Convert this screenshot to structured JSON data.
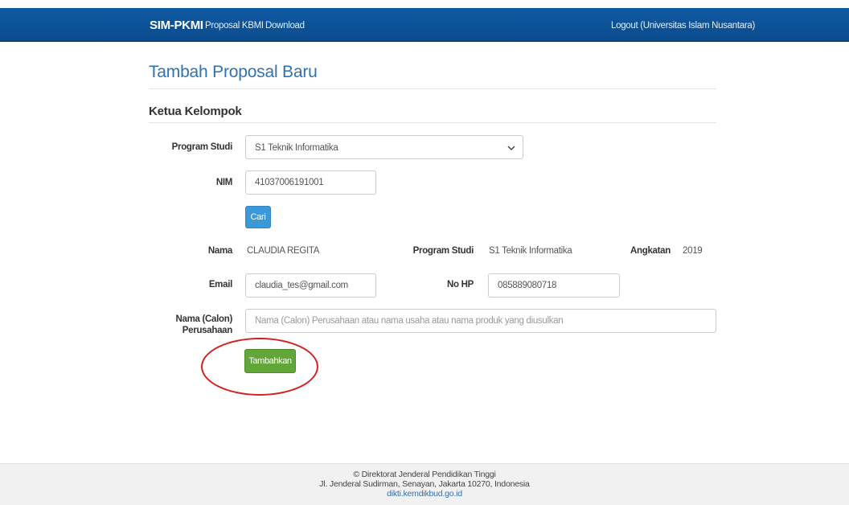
{
  "navbar": {
    "brand": "SIM-PKMI",
    "links": [
      "Proposal KBMI",
      "Download"
    ],
    "logout": "Logout (Universitas Islam Nusantara)"
  },
  "page": {
    "title": "Tambah Proposal Baru",
    "section": "Ketua Kelompok"
  },
  "form": {
    "program_studi_label": "Program Studi",
    "program_studi_value": "S1 Teknik Informatika",
    "nim_label": "NIM",
    "nim_value": "41037006191001",
    "cari_label": "Cari",
    "nama_label": "Nama",
    "nama_value": "CLAUDIA REGITA",
    "prodi_label": "Program Studi",
    "prodi_value": "S1 Teknik Informatika",
    "angkatan_label": "Angkatan",
    "angkatan_value": "2019",
    "email_label": "Email",
    "email_value": "claudia_tes@gmail.com",
    "nohp_label": "No HP",
    "nohp_value": "085889080718",
    "perusahaan_label_1": "Nama (Calon)",
    "perusahaan_label_2": "Perusahaan",
    "perusahaan_placeholder": "Nama (Calon) Perusahaan atau nama usaha atau nama produk yang diusulkan",
    "submit_label": "Tambahkan"
  },
  "footer": {
    "line1": "© Direktorat Jenderal Pendidikan Tinggi",
    "line2": "Jl. Jenderal Sudirman, Senayan, Jakarta 10270, Indonesia",
    "link": "dikti.kemdikbud.go.id"
  },
  "colors": {
    "navbar": "#0f5aa3",
    "title": "#2f72b0",
    "cari_button": "#3a9ad9",
    "submit_button": "#62a63a",
    "highlight": "#d32020"
  }
}
